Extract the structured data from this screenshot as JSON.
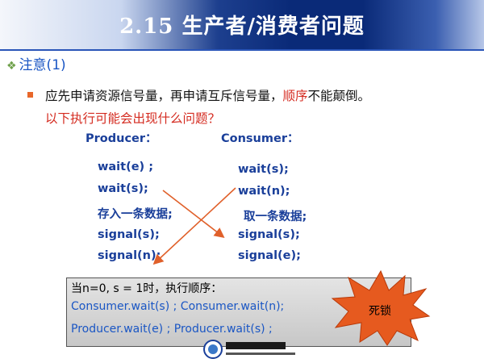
{
  "title": "2.15 生产者/消费者问题",
  "section": "注意(1)",
  "bullet": {
    "part1": "应先申请资源信号量，再申请互斥信号量，",
    "highlight": "顺序",
    "part2": "不能颠倒。"
  },
  "question": "以下执行可能会出现什么问题？",
  "producer": {
    "header": "Producer：",
    "lines": [
      "wait(e) ;",
      "wait(s);",
      "存入一条数据;",
      "signal(s);",
      "signal(n);"
    ]
  },
  "consumer": {
    "header": "Consumer：",
    "lines": [
      "wait(s);",
      "wait(n);",
      "取一条数据;",
      "signal(s);",
      "signal(e);"
    ]
  },
  "condition": {
    "header": "当n=0, s = 1时，执行顺序：",
    "line1": "Consumer.wait(s) ; Consumer.wait(n);",
    "line2": "Producer.wait(e) ; Producer.wait(s) ;"
  },
  "deadlock_label": "死锁",
  "colors": {
    "title_bg": "#0a2a78",
    "code_blue": "#1a3f9a",
    "emphasis_red": "#d42a1f",
    "arrow": "#e0602a",
    "burst": "#e65a1f"
  },
  "icons": {
    "section_marker": "diamond-cluster-icon",
    "bullet": "square-bullet-icon",
    "logo": "university-logo-icon"
  }
}
